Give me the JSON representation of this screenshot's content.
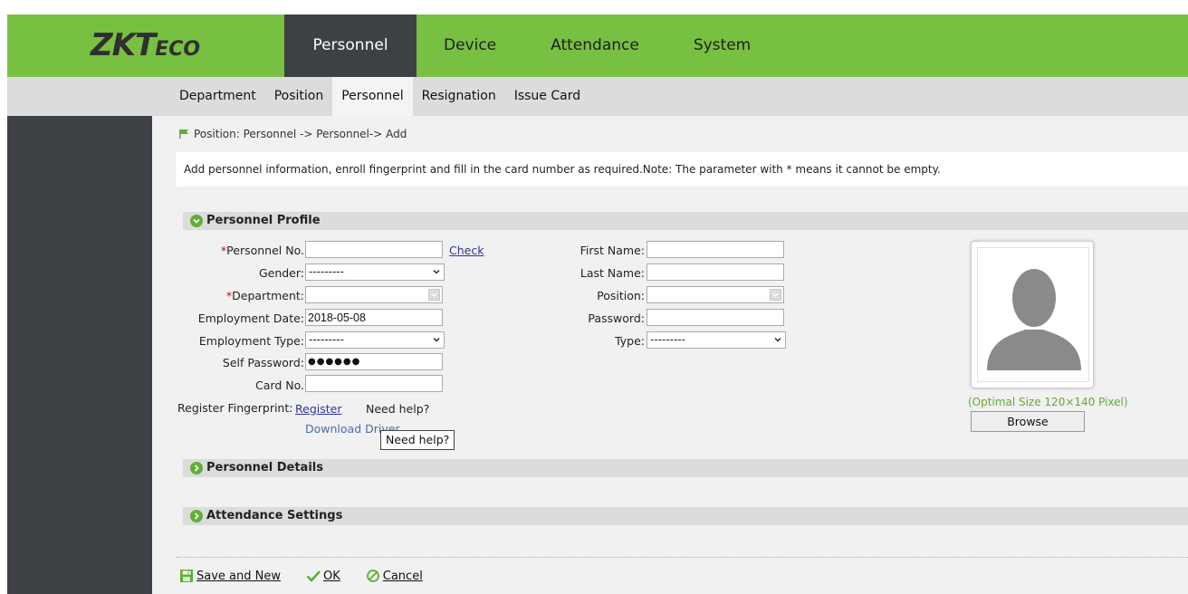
{
  "brand": {
    "logo_main": "ZKT",
    "logo_sub": "ECO"
  },
  "main_nav": [
    "Personnel",
    "Device",
    "Attendance",
    "System"
  ],
  "sub_nav": [
    "Department",
    "Position",
    "Personnel",
    "Resignation",
    "Issue Card"
  ],
  "breadcrumb": "Position: Personnel -> Personnel-> Add",
  "info_text": "Add personnel information, enroll fingerprint and fill in the card number as required.Note: The parameter with * means it cannot be empty.",
  "sections": {
    "profile": "Personnel Profile",
    "details": "Personnel Details",
    "attendance": "Attendance Settings"
  },
  "form": {
    "required_mark": "*",
    "personnel_no_label": "Personnel No.",
    "personnel_no_value": "",
    "check_link": "Check",
    "gender_label": "Gender:",
    "gender_value": "---------",
    "department_label": "Department:",
    "department_value": "",
    "employment_date_label": "Employment Date:",
    "employment_date_value": "2018-05-08",
    "employment_type_label": "Employment Type:",
    "employment_type_value": "---------",
    "self_password_label": "Self Password:",
    "self_password_value": "●●●●●●",
    "card_no_label": "Card No.",
    "card_no_value": "",
    "register_fp_label": "Register Fingerprint:",
    "register_link": "Register",
    "need_help": "Need help?",
    "download_driver": "Download Driver",
    "first_name_label": "First Name:",
    "first_name_value": "",
    "last_name_label": "Last Name:",
    "last_name_value": "",
    "position_label": "Position:",
    "position_value": "",
    "password_label": "Password:",
    "password_value": "",
    "type_label": "Type:",
    "type_value": "---------"
  },
  "photo": {
    "optimal_size": "(Optimal Size 120×140 Pixel)",
    "browse_label": "Browse"
  },
  "tooltip": "Need help?",
  "actions": {
    "save_new": "Save and New",
    "ok": "OK",
    "cancel": "Cancel"
  },
  "colors": {
    "topbar": "#78c042",
    "dark": "#3d4044",
    "accent_green": "#5fae36"
  }
}
